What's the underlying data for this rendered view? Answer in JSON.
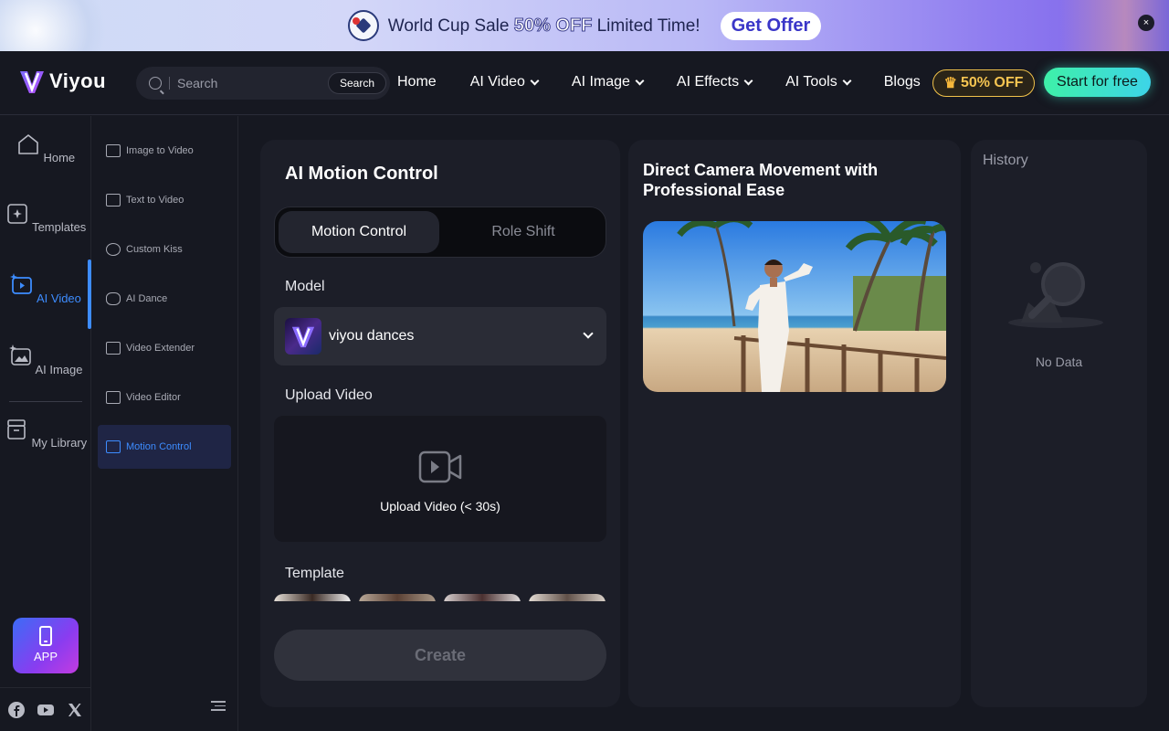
{
  "promo": {
    "text_before": "World Cup Sale",
    "highlight": "50% OFF",
    "text_after": "Limited Time!",
    "offer_label": "Get Offer",
    "close_label": "×"
  },
  "header": {
    "brand": "Viyou",
    "search_placeholder": "Search",
    "search_button": "Search",
    "nav": [
      {
        "label": "Home",
        "dropdown": false
      },
      {
        "label": "AI Video",
        "dropdown": true
      },
      {
        "label": "AI Image",
        "dropdown": true
      },
      {
        "label": "AI Effects",
        "dropdown": true
      },
      {
        "label": "AI Tools",
        "dropdown": true
      },
      {
        "label": "Blogs",
        "dropdown": false
      }
    ],
    "discount_label": "50% OFF",
    "start_label": "Start for free"
  },
  "rail": {
    "items": [
      {
        "label": "Home",
        "icon": "home-icon"
      },
      {
        "label": "Templates",
        "icon": "templates-icon"
      },
      {
        "label": "AI Video",
        "icon": "video-icon",
        "active": true
      },
      {
        "label": "AI Image",
        "icon": "image-icon"
      },
      {
        "label": "My Library",
        "icon": "library-icon"
      }
    ],
    "app_label": "APP"
  },
  "submenu": {
    "items": [
      {
        "label": "Image to Video"
      },
      {
        "label": "Text to Video"
      },
      {
        "label": "Custom Kiss"
      },
      {
        "label": "AI Dance"
      },
      {
        "label": "Video Extender"
      },
      {
        "label": "Video Editor"
      },
      {
        "label": "Motion Control",
        "active": true
      }
    ]
  },
  "panel": {
    "title": "AI Motion Control",
    "tabs": [
      "Motion Control",
      "Role Shift"
    ],
    "model_label": "Model",
    "model_name": "viyou dances",
    "upload_label": "Upload Video",
    "upload_hint": "Upload Video (< 30s)",
    "template_label": "Template",
    "create_label": "Create"
  },
  "preview": {
    "title": "Direct Camera Movement with Professional Ease"
  },
  "history": {
    "title": "History",
    "empty_text": "No Data"
  },
  "colors": {
    "accent": "#3d8cff",
    "start_gradient_from": "#3ef0a8",
    "start_gradient_to": "#3dd4e8",
    "discount": "#f5c451"
  }
}
